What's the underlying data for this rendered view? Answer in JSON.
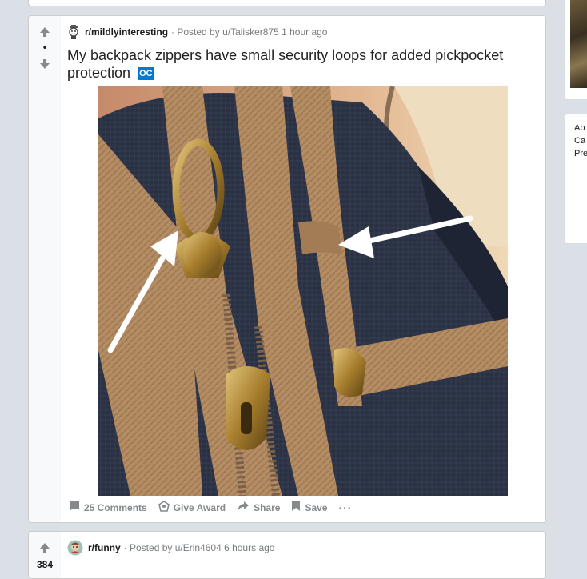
{
  "post1": {
    "subreddit": "r/mildlyinteresting",
    "posted_by": "· Posted by u/Talisker875 1 hour ago",
    "title": "My backpack zippers have small security loops for added pickpocket protection",
    "flair": "OC",
    "vote_dot": "•",
    "actions": {
      "comments": "25 Comments",
      "award": "Give Award",
      "share": "Share",
      "save": "Save",
      "more": "···"
    }
  },
  "post2": {
    "subreddit": "r/funny",
    "posted_by": "· Posted by u/Erin4604 6 hours ago",
    "vote_count": "384"
  },
  "sidebar": {
    "text_lines": [
      "Ab",
      "Ca",
      "Pre"
    ]
  },
  "colors": {
    "background": "#dae0e6",
    "accent": "#0079d3",
    "meta_text": "#787c7e"
  },
  "icons": {
    "upvote": "arrow-up-icon",
    "downvote": "arrow-down-icon",
    "comments": "comment-icon",
    "award": "award-icon",
    "share": "share-icon",
    "save": "bookmark-icon"
  }
}
